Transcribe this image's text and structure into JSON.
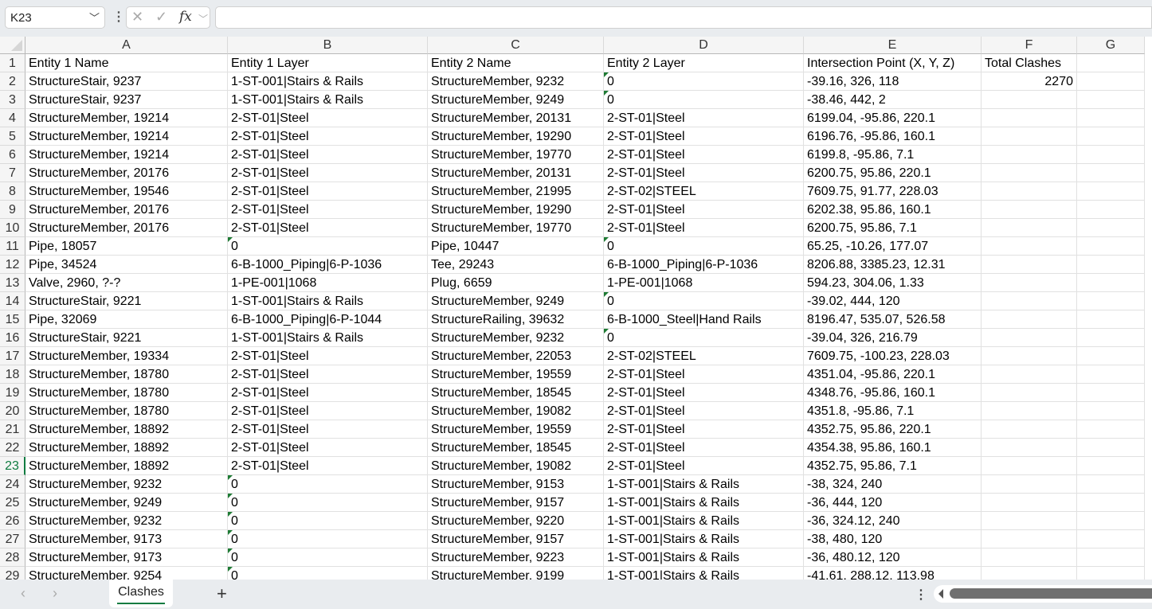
{
  "formula_bar": {
    "name_box": "K23",
    "cancel_icon": "✕",
    "enter_icon": "✓",
    "fx_label": "fx",
    "formula": ""
  },
  "columns": [
    "A",
    "B",
    "C",
    "D",
    "E",
    "F",
    "G"
  ],
  "selected_row": 23,
  "rows": [
    [
      "Entity 1 Name",
      "Entity 1 Layer",
      "Entity 2 Name",
      "Entity 2 Layer",
      "Intersection Point (X, Y, Z)",
      "Total Clashes",
      ""
    ],
    [
      "StructureStair, 9237",
      "1-ST-001|Stairs & Rails",
      "StructureMember, 9232",
      "0",
      "-39.16, 326, 118",
      "2270",
      ""
    ],
    [
      "StructureStair, 9237",
      "1-ST-001|Stairs & Rails",
      "StructureMember, 9249",
      "0",
      "-38.46, 442, 2",
      "",
      ""
    ],
    [
      "StructureMember, 19214",
      "2-ST-01|Steel",
      "StructureMember, 20131",
      "2-ST-01|Steel",
      "6199.04, -95.86, 220.1",
      "",
      ""
    ],
    [
      "StructureMember, 19214",
      "2-ST-01|Steel",
      "StructureMember, 19290",
      "2-ST-01|Steel",
      "6196.76, -95.86, 160.1",
      "",
      ""
    ],
    [
      "StructureMember, 19214",
      "2-ST-01|Steel",
      "StructureMember, 19770",
      "2-ST-01|Steel",
      "6199.8, -95.86, 7.1",
      "",
      ""
    ],
    [
      "StructureMember, 20176",
      "2-ST-01|Steel",
      "StructureMember, 20131",
      "2-ST-01|Steel",
      "6200.75, 95.86, 220.1",
      "",
      ""
    ],
    [
      "StructureMember, 19546",
      "2-ST-01|Steel",
      "StructureMember, 21995",
      "2-ST-02|STEEL",
      "7609.75, 91.77, 228.03",
      "",
      ""
    ],
    [
      "StructureMember, 20176",
      "2-ST-01|Steel",
      "StructureMember, 19290",
      "2-ST-01|Steel",
      "6202.38, 95.86, 160.1",
      "",
      ""
    ],
    [
      "StructureMember, 20176",
      "2-ST-01|Steel",
      "StructureMember, 19770",
      "2-ST-01|Steel",
      "6200.75, 95.86, 7.1",
      "",
      ""
    ],
    [
      "Pipe, 18057",
      "0",
      "Pipe, 10447",
      "0",
      "65.25, -10.26, 177.07",
      "",
      ""
    ],
    [
      "Pipe, 34524",
      "6-B-1000_Piping|6-P-1036",
      "Tee, 29243",
      "6-B-1000_Piping|6-P-1036",
      "8206.88, 3385.23, 12.31",
      "",
      ""
    ],
    [
      "Valve, 2960, ?-?",
      "1-PE-001|1068",
      "Plug, 6659",
      "1-PE-001|1068",
      "594.23, 304.06, 1.33",
      "",
      ""
    ],
    [
      "StructureStair, 9221",
      "1-ST-001|Stairs & Rails",
      "StructureMember, 9249",
      "0",
      "-39.02, 444, 120",
      "",
      ""
    ],
    [
      "Pipe, 32069",
      "6-B-1000_Piping|6-P-1044",
      "StructureRailing, 39632",
      "6-B-1000_Steel|Hand Rails",
      "8196.47, 535.07, 526.58",
      "",
      ""
    ],
    [
      "StructureStair, 9221",
      "1-ST-001|Stairs & Rails",
      "StructureMember, 9232",
      "0",
      "-39.04, 326, 216.79",
      "",
      ""
    ],
    [
      "StructureMember, 19334",
      "2-ST-01|Steel",
      "StructureMember, 22053",
      "2-ST-02|STEEL",
      "7609.75, -100.23, 228.03",
      "",
      ""
    ],
    [
      "StructureMember, 18780",
      "2-ST-01|Steel",
      "StructureMember, 19559",
      "2-ST-01|Steel",
      "4351.04, -95.86, 220.1",
      "",
      ""
    ],
    [
      "StructureMember, 18780",
      "2-ST-01|Steel",
      "StructureMember, 18545",
      "2-ST-01|Steel",
      "4348.76, -95.86, 160.1",
      "",
      ""
    ],
    [
      "StructureMember, 18780",
      "2-ST-01|Steel",
      "StructureMember, 19082",
      "2-ST-01|Steel",
      "4351.8, -95.86, 7.1",
      "",
      ""
    ],
    [
      "StructureMember, 18892",
      "2-ST-01|Steel",
      "StructureMember, 19559",
      "2-ST-01|Steel",
      "4352.75, 95.86, 220.1",
      "",
      ""
    ],
    [
      "StructureMember, 18892",
      "2-ST-01|Steel",
      "StructureMember, 18545",
      "2-ST-01|Steel",
      "4354.38, 95.86, 160.1",
      "",
      ""
    ],
    [
      "StructureMember, 18892",
      "2-ST-01|Steel",
      "StructureMember, 19082",
      "2-ST-01|Steel",
      "4352.75, 95.86, 7.1",
      "",
      ""
    ],
    [
      "StructureMember, 9232",
      "0",
      "StructureMember, 9153",
      "1-ST-001|Stairs & Rails",
      "-38, 324, 240",
      "",
      ""
    ],
    [
      "StructureMember, 9249",
      "0",
      "StructureMember, 9157",
      "1-ST-001|Stairs & Rails",
      "-36, 444, 120",
      "",
      ""
    ],
    [
      "StructureMember, 9232",
      "0",
      "StructureMember, 9220",
      "1-ST-001|Stairs & Rails",
      "-36, 324.12, 240",
      "",
      ""
    ],
    [
      "StructureMember, 9173",
      "0",
      "StructureMember, 9157",
      "1-ST-001|Stairs & Rails",
      "-38, 480, 120",
      "",
      ""
    ],
    [
      "StructureMember, 9173",
      "0",
      "StructureMember, 9223",
      "1-ST-001|Stairs & Rails",
      "-36, 480.12, 120",
      "",
      ""
    ],
    [
      "StructureMember, 9254",
      "0",
      "StructureMember, 9199",
      "1-ST-001|Stairs & Rails",
      "-41.61, 288.12, 113.98",
      "",
      ""
    ]
  ],
  "sheet_tabs": [
    {
      "label": "Clashes",
      "active": true
    }
  ],
  "add_sheet_label": "+",
  "colors": {
    "accent": "#107c41",
    "text_number_flag": "#1e7b34"
  }
}
